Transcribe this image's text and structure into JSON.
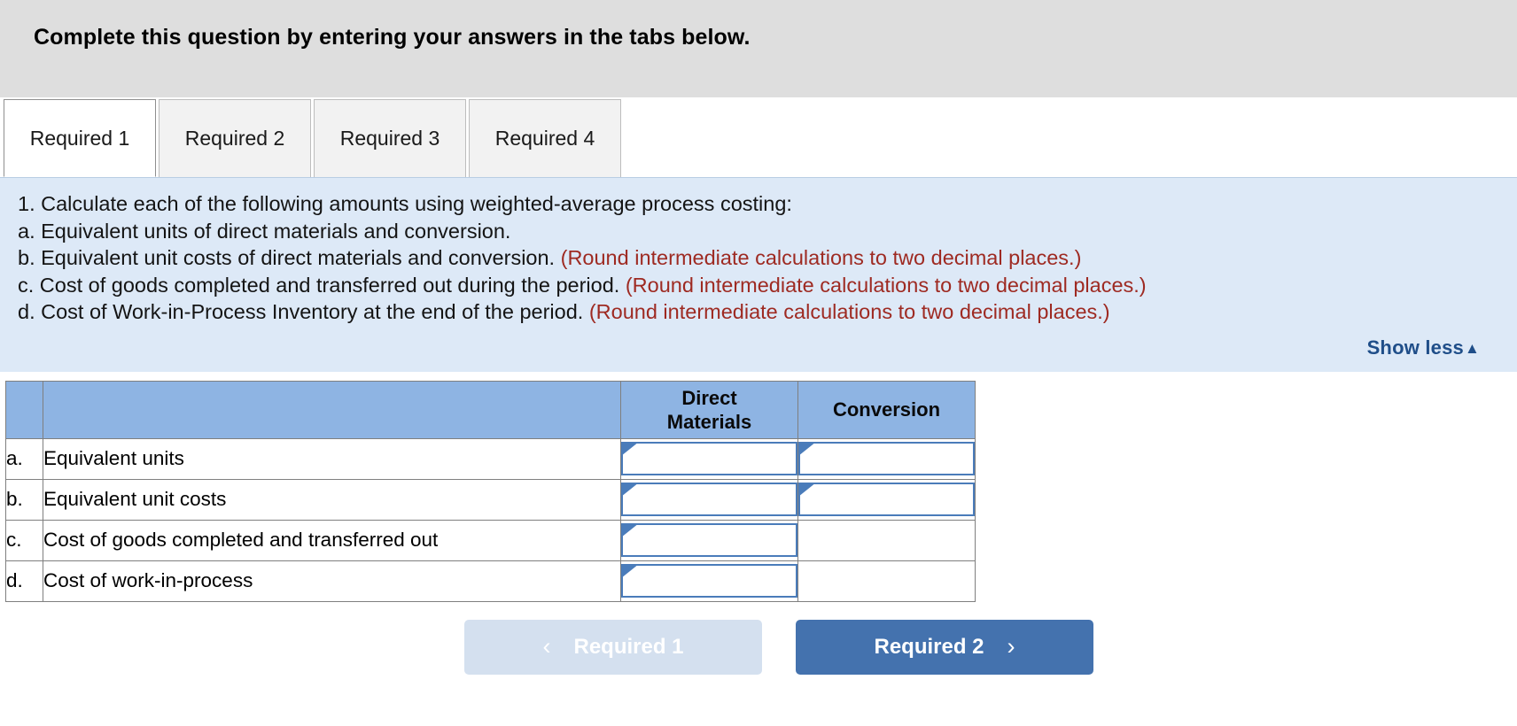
{
  "banner": {
    "title": "Complete this question by entering your answers in the tabs below."
  },
  "tabs": [
    {
      "label": "Required 1",
      "active": true
    },
    {
      "label": "Required 2",
      "active": false
    },
    {
      "label": "Required 3",
      "active": false
    },
    {
      "label": "Required 4",
      "active": false
    }
  ],
  "instructions": {
    "lines": [
      {
        "text": "1. Calculate each of the following amounts using weighted-average process costing:",
        "note": ""
      },
      {
        "text": "a. Equivalent units of direct materials and conversion.",
        "note": ""
      },
      {
        "text": "b. Equivalent unit costs of direct materials and conversion. ",
        "note": "(Round intermediate calculations to two decimal places.)"
      },
      {
        "text": "c. Cost of goods completed and transferred out during the period. ",
        "note": "(Round intermediate calculations to two decimal places.)"
      },
      {
        "text": "d. Cost of Work-in-Process Inventory at the end of the period. ",
        "note": "(Round intermediate calculations to two decimal places.)"
      }
    ],
    "show_less_label": "Show less",
    "show_less_caret": "▲"
  },
  "table": {
    "headers": [
      "",
      "",
      "Direct\nMaterials",
      "Conversion"
    ],
    "header_dm": "Direct Materials",
    "header_dm_line1": "Direct",
    "header_dm_line2": "Materials",
    "header_conversion": "Conversion",
    "rows": [
      {
        "letter": "a.",
        "label": "Equivalent units",
        "dm_input": true,
        "cv_input": true,
        "dm_value": "",
        "cv_value": ""
      },
      {
        "letter": "b.",
        "label": "Equivalent unit costs",
        "dm_input": true,
        "cv_input": true,
        "dm_value": "",
        "cv_value": ""
      },
      {
        "letter": "c.",
        "label": "Cost of goods completed and transferred out",
        "dm_input": true,
        "cv_input": false,
        "dm_value": "",
        "cv_value": ""
      },
      {
        "letter": "d.",
        "label": "Cost of work-in-process",
        "dm_input": true,
        "cv_input": false,
        "dm_value": "",
        "cv_value": ""
      }
    ]
  },
  "nav": {
    "prev_label": "Required 1",
    "prev_chevron": "‹",
    "prev_disabled": true,
    "next_label": "Required 2",
    "next_chevron": "›"
  },
  "colors": {
    "banner_bg": "#dedede",
    "instructions_bg": "#dde9f7",
    "note_red": "#9e2a22",
    "link_blue": "#1f4e89",
    "table_header_blue": "#8eb4e3",
    "input_border_blue": "#4a7cba",
    "next_button_blue": "#4472ae",
    "prev_button_blue": "#d4e0ef"
  }
}
